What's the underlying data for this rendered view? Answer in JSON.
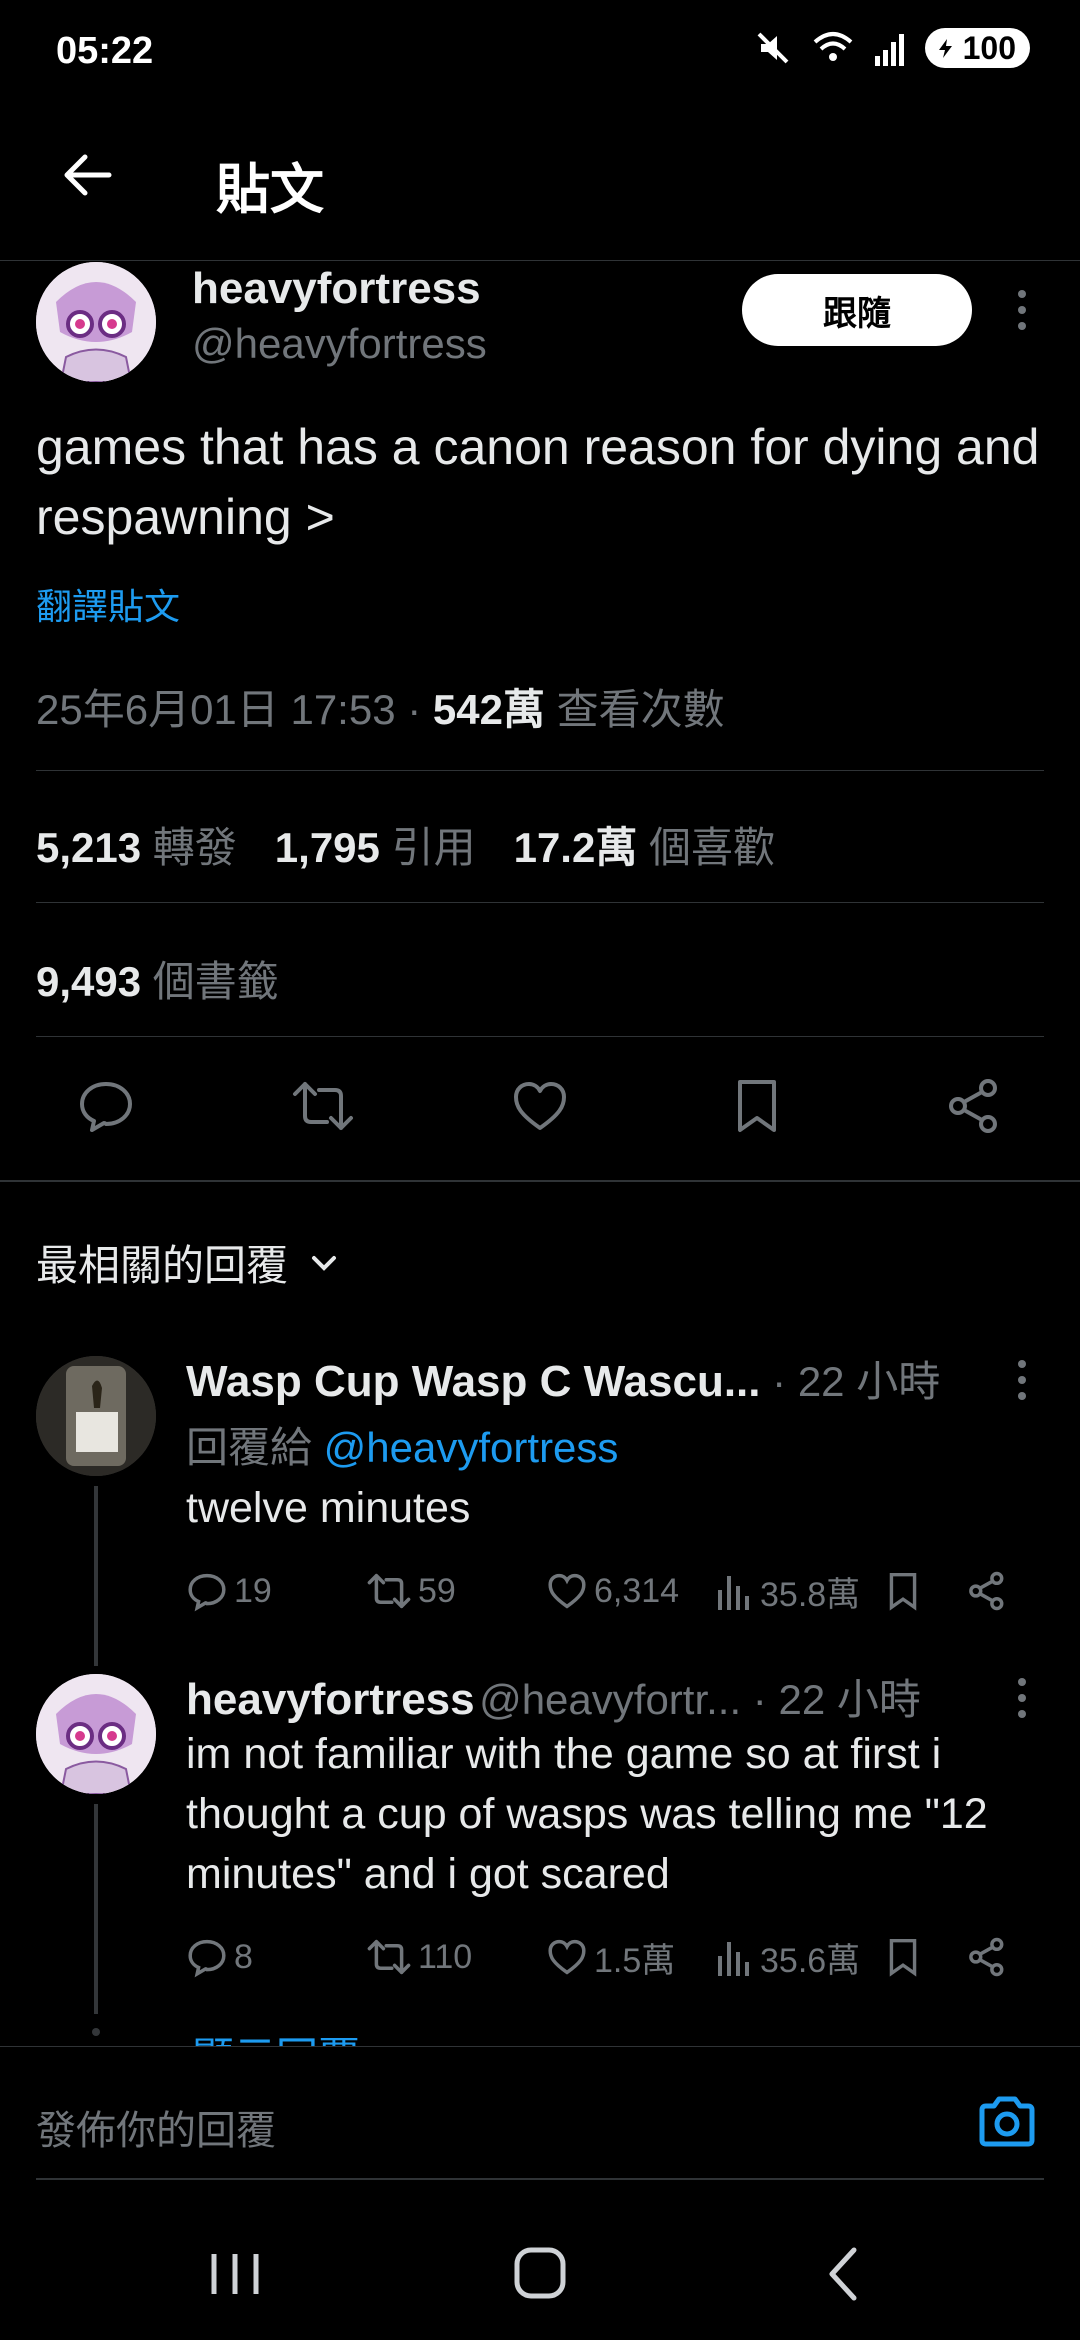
{
  "status": {
    "time": "05:22",
    "battery": "100"
  },
  "header": {
    "title": "貼文"
  },
  "post": {
    "author_name": "heavyfortress",
    "author_handle": "@heavyfortress",
    "follow_label": "跟隨",
    "text": "games that has a canon reason for dying and respawning >",
    "translate_label": "翻譯貼文",
    "timestamp": "25年6月01日 17:53 · ",
    "views_count": "542萬",
    "views_label": " 查看次數",
    "reposts_count": "5,213",
    "reposts_label": "轉發",
    "quotes_count": "1,795",
    "quotes_label": "引用",
    "likes_count": "17.2萬",
    "likes_label": "個喜歡",
    "bookmarks_count": "9,493",
    "bookmarks_label": "個書籤"
  },
  "replies_section": {
    "title": "最相關的回覆"
  },
  "replies": [
    {
      "name": "Wasp Cup Wasp C Wascu...",
      "time": " · 22 小時",
      "reply_to_label": "回覆給 ",
      "reply_to_handle": "@heavyfortress",
      "text": "twelve minutes",
      "comments": "19",
      "reposts": "59",
      "likes": "6,314",
      "views": "35.8萬"
    },
    {
      "name": "heavyfortress",
      "handle": "@heavyfortr...",
      "time": " · 22 小時",
      "text": "im not familiar with the game so at first i thought a cup of wasps was telling me \"12 minutes\" and i got scared",
      "comments": "8",
      "reposts": "110",
      "likes": "1.5萬",
      "views": "35.6萬"
    }
  ],
  "show_replies_label": "顯示回覆",
  "composer": {
    "placeholder": "發佈你的回覆"
  },
  "colors": {
    "accent": "#1d9bf0",
    "background": "#000000",
    "muted": "#71767b",
    "text": "#e7e9ea"
  },
  "icons": [
    "mute-icon",
    "wifi-icon",
    "signal-icon",
    "battery-icon",
    "back-arrow-icon",
    "more-icon",
    "comment-icon",
    "repost-icon",
    "like-icon",
    "bookmark-icon",
    "share-icon",
    "views-icon",
    "chevron-down-icon",
    "camera-icon",
    "nav-recents-icon",
    "nav-home-icon",
    "nav-back-icon"
  ]
}
